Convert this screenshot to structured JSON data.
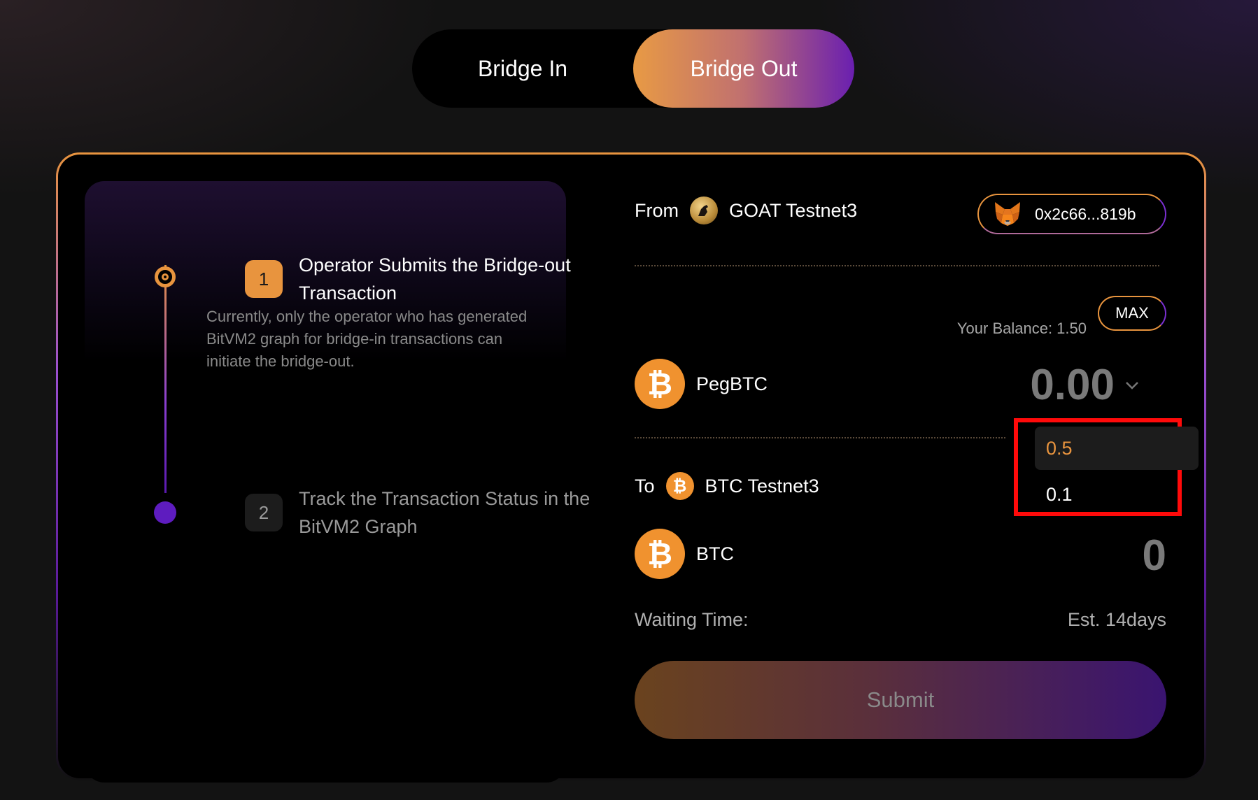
{
  "toggle": {
    "bridge_in": "Bridge In",
    "bridge_out": "Bridge Out",
    "active": "Bridge Out"
  },
  "steps": [
    {
      "number": "1",
      "title": "Operator Submits the Bridge-out Transaction",
      "description": "Currently, only the operator who has generated BitVM2 graph for bridge-in transactions can initiate the bridge-out.",
      "status": "active"
    },
    {
      "number": "2",
      "title": "Track the Transaction Status in the BitVM2 Graph",
      "status": "pending"
    }
  ],
  "form": {
    "from_label": "From",
    "from_network": "GOAT Testnet3",
    "wallet_address": "0x2c66...819b",
    "balance_label": "Your Balance: 1.50",
    "max_label": "MAX",
    "source_token": "PegBTC",
    "source_amount": "0.00",
    "to_label": "To",
    "to_network": "BTC Testnet3",
    "target_token": "BTC",
    "target_amount": "0",
    "waiting_label": "Waiting Time:",
    "waiting_value": "Est. 14days",
    "submit_label": "Submit"
  },
  "amount_dropdown": {
    "options": [
      "0.5",
      "0.1"
    ],
    "highlighted": "0.5"
  },
  "colors": {
    "accent_orange": "#e8943e",
    "accent_purple": "#6a1fb0",
    "highlight_box": "#ff0a0a"
  },
  "icons": {
    "wallet": "metamask-fox-icon",
    "goat_network": "goat-network-icon",
    "btc": "bitcoin-icon"
  }
}
